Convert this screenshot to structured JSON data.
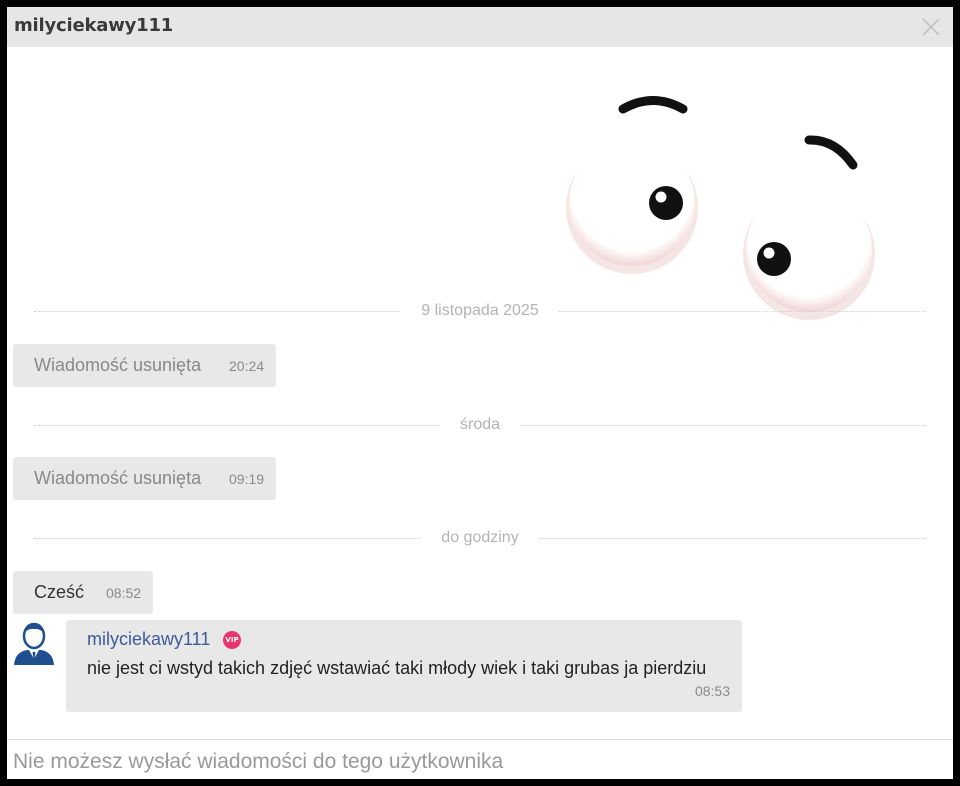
{
  "window": {
    "title": "milyciekawy111"
  },
  "dividers": [
    "9 listopada 2025",
    "środa",
    "do godziny"
  ],
  "messages": [
    {
      "text": "Wiadomość usunięta",
      "time": "20:24"
    },
    {
      "text": "Wiadomość usunięta",
      "time": "09:19"
    },
    {
      "text": "Cześć",
      "time": "08:52"
    }
  ],
  "incoming": {
    "sender": "milyciekawy111",
    "badge": "VIP",
    "text": "nie jest ci wstyd takich zdjęć wstawiać taki młody wiek i taki grubas ja pierdziu",
    "time": "08:53"
  },
  "footer": {
    "placeholder": "Nie możesz wysłać wiadomości do tego użytkownika"
  },
  "icons": {
    "close": "close-icon",
    "avatar": "user-avatar-icon",
    "background": "cartoon-eyes-illustration"
  },
  "colors": {
    "titlebar": "#e6e6e6",
    "bubble": "#e8e8e8",
    "sender": "#3d5b9c",
    "vip": "#e8356d",
    "avatar": "#1f4f8f"
  }
}
